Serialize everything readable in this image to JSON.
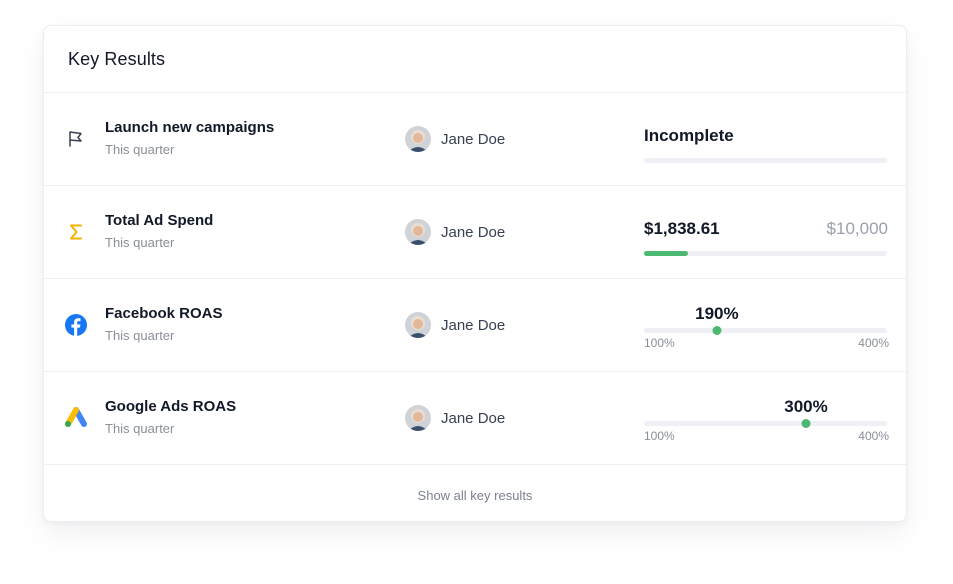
{
  "card": {
    "title": "Key Results",
    "footer_link": "Show all key results"
  },
  "rows": [
    {
      "icon": "flag-icon",
      "title": "Launch new campaigns",
      "period": "This quarter",
      "owner": "Jane Doe",
      "metric": {
        "type": "status",
        "label": "Incomplete"
      }
    },
    {
      "icon": "sigma-icon",
      "icon_color": "#f5b400",
      "title": "Total Ad Spend",
      "period": "This quarter",
      "owner": "Jane Doe",
      "metric": {
        "type": "money",
        "current": "$1,838.61",
        "target": "$10,000",
        "progress_fraction": 0.18
      }
    },
    {
      "icon": "facebook-icon",
      "icon_color": "#1877f2",
      "title": "Facebook ROAS",
      "period": "This quarter",
      "owner": "Jane Doe",
      "metric": {
        "type": "range",
        "value_label": "190%",
        "min_label": "100%",
        "max_label": "400%",
        "value": 190,
        "min": 100,
        "max": 400
      }
    },
    {
      "icon": "google-ads-icon",
      "title": "Google Ads ROAS",
      "period": "This quarter",
      "owner": "Jane Doe",
      "metric": {
        "type": "range",
        "value_label": "300%",
        "min_label": "100%",
        "max_label": "400%",
        "value": 300,
        "min": 100,
        "max": 400
      }
    }
  ],
  "colors": {
    "progress_green": "#4cb972",
    "track_gray": "#eef0f5"
  }
}
